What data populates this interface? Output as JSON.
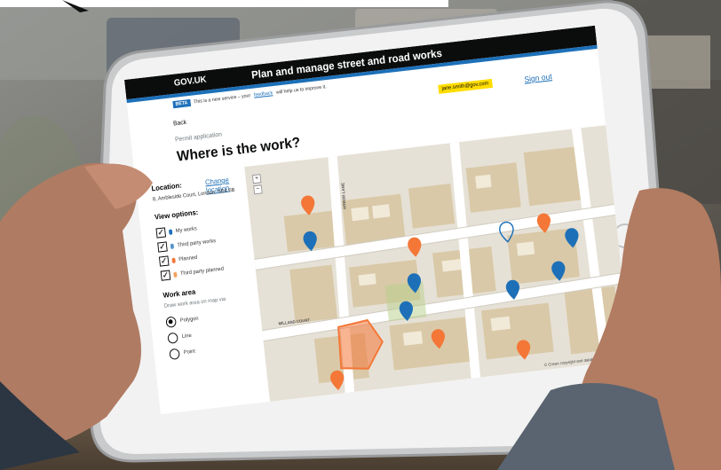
{
  "header": {
    "logo": "GOV.UK",
    "service_name": "Plan and manage street and road works"
  },
  "phase_banner": {
    "tag": "BETA",
    "text": "This is a new service – your",
    "link": "feedback",
    "suffix": "will help us to improve it."
  },
  "user": {
    "email": "jane.smith@gov.com",
    "sign_out": "Sign out"
  },
  "back_link": "Back",
  "caption": "Permit application",
  "heading": "Where is the work?",
  "sidebar": {
    "location_label": "Location:",
    "change_link": "Change location",
    "address": "8, Ambleside Court, London, SE4 6B",
    "view_options_label": "View options:",
    "view_options": [
      {
        "label": "My works",
        "checked": true,
        "color": "#1d70b8"
      },
      {
        "label": "Third party works",
        "checked": true,
        "color": "#5694ca"
      },
      {
        "label": "Planned",
        "checked": true,
        "color": "#f47738"
      },
      {
        "label": "Third party planned",
        "checked": true,
        "color": "#f4a35f"
      }
    ],
    "work_area_label": "Work area",
    "work_area_hint": "Draw work area on map via",
    "work_area_options": [
      {
        "label": "Polygon",
        "selected": true
      },
      {
        "label": "Line",
        "selected": false
      },
      {
        "label": "Point",
        "selected": false
      }
    ]
  },
  "map": {
    "zoom_in": "+",
    "zoom_out": "−",
    "street_labels": [
      "MILLAND COURT",
      "ARBOR LANE"
    ],
    "attribution": "© Crown copyright and database rights 2018 OS",
    "colors": {
      "my_works": "#1d70b8",
      "planned": "#f47738",
      "selected_area": "#f47738"
    }
  }
}
